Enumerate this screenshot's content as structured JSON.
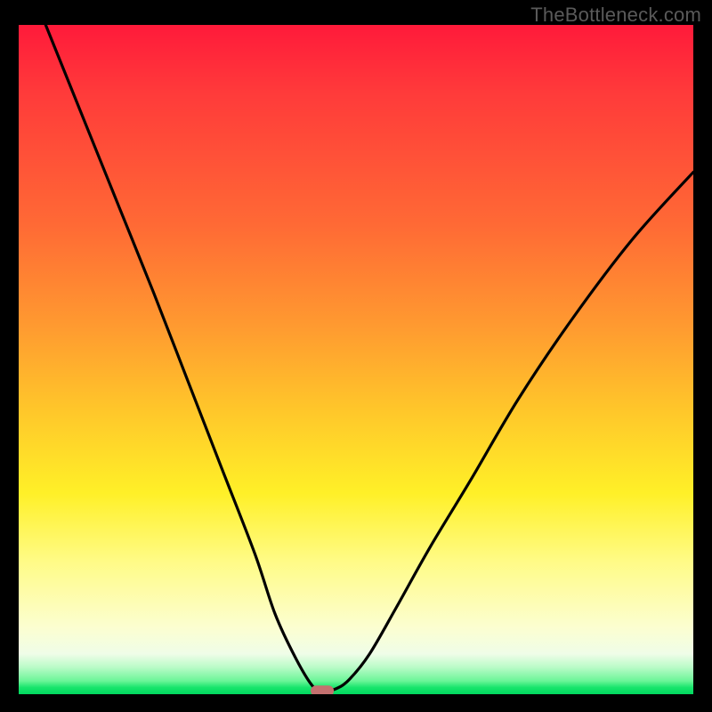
{
  "attribution": "TheBottleneck.com",
  "chart_data": {
    "type": "line",
    "title": "",
    "xlabel": "",
    "ylabel": "",
    "xlim": [
      0,
      100
    ],
    "ylim": [
      0,
      100
    ],
    "grid": false,
    "legend": false,
    "background": "gradient red-yellow-green (top to bottom)",
    "series": [
      {
        "name": "bottleneck-curve",
        "x": [
          4,
          10,
          15,
          20,
          25,
          30,
          35,
          38,
          41,
          43.5,
          45,
          47,
          49,
          52,
          56,
          61,
          67,
          74,
          82,
          91,
          100
        ],
        "y": [
          100,
          85,
          72.5,
          60,
          47,
          34,
          21,
          12,
          5.5,
          1.3,
          0.5,
          0.8,
          2.2,
          6,
          13,
          22,
          32,
          44,
          56,
          68,
          78
        ],
        "color": "#000000"
      }
    ],
    "annotations": [
      {
        "name": "min-marker",
        "x": 45,
        "y": 0.5,
        "shape": "rounded-rect",
        "color": "#c4706f"
      }
    ]
  },
  "colors": {
    "page_bg": "#000000",
    "curve": "#000000",
    "marker": "#c4706f",
    "attribution": "#5a5a5a"
  }
}
